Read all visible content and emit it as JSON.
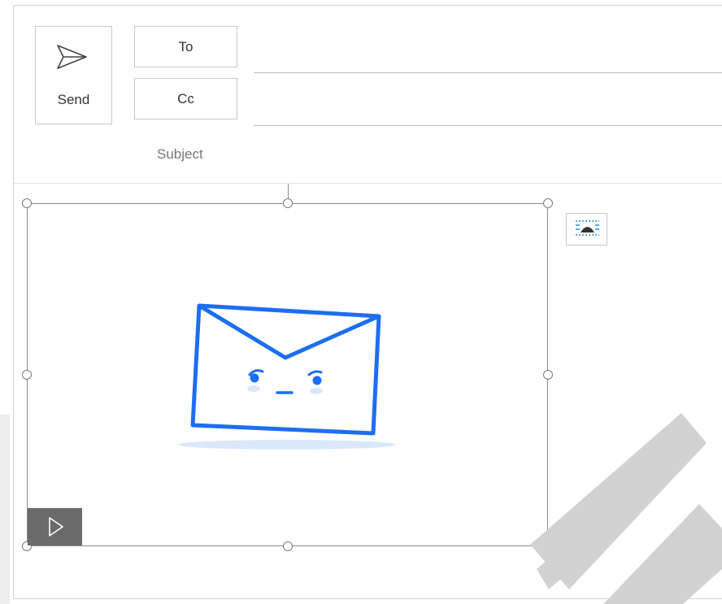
{
  "compose": {
    "send_label": "Send",
    "to_label": "To",
    "cc_label": "Cc",
    "subject_label": "Subject",
    "to_value": "",
    "cc_value": ""
  },
  "body_image": {
    "alt": "envelope illustration"
  },
  "icons": {
    "send": "send-arrow-icon",
    "play": "play-icon",
    "layout_options": "layout-options-icon"
  },
  "colors": {
    "envelope_blue": "#1c6ef2",
    "shadow_blue": "#dbe8fb",
    "play_bg": "#6b6b6b",
    "watermark": "#cfcfcf"
  }
}
